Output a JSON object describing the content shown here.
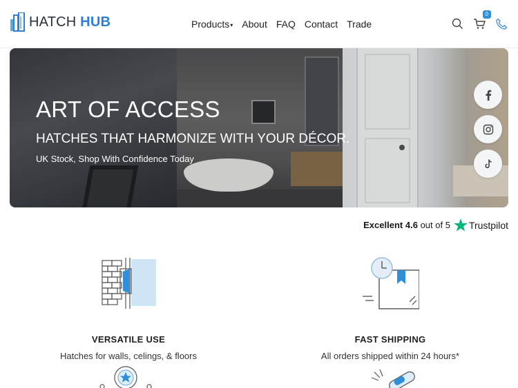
{
  "brand": {
    "name_part1": "HATCH",
    "name_part2": "HUB",
    "accent": "#2f7fd4"
  },
  "nav": {
    "items": [
      {
        "label": "Products",
        "has_dropdown": true
      },
      {
        "label": "About"
      },
      {
        "label": "FAQ"
      },
      {
        "label": "Contact"
      },
      {
        "label": "Trade"
      }
    ]
  },
  "header_icons": {
    "search": "search-icon",
    "cart": "cart-icon",
    "phone": "phone-icon",
    "cart_count": "0"
  },
  "hero": {
    "title": "ART OF ACCESS",
    "subtitle": "HATCHES THAT HARMONIZE WITH YOUR DÉCOR.",
    "tagline": "UK Stock, Shop With Confidence Today",
    "social": [
      "facebook-icon",
      "instagram-icon",
      "tiktok-icon"
    ]
  },
  "trustpilot": {
    "rating_word": "Excellent",
    "score": "4.6",
    "suffix": "out of 5",
    "brand": "Trustpilot",
    "star_color": "#00b67a"
  },
  "features": [
    {
      "title": "VERSATILE USE",
      "desc": "Hatches for walls, celings, & floors",
      "icon": "hatch-wall-icon"
    },
    {
      "title": "FAST SHIPPING",
      "desc": "All orders shipped within 24 hours*",
      "icon": "package-clock-icon"
    }
  ]
}
